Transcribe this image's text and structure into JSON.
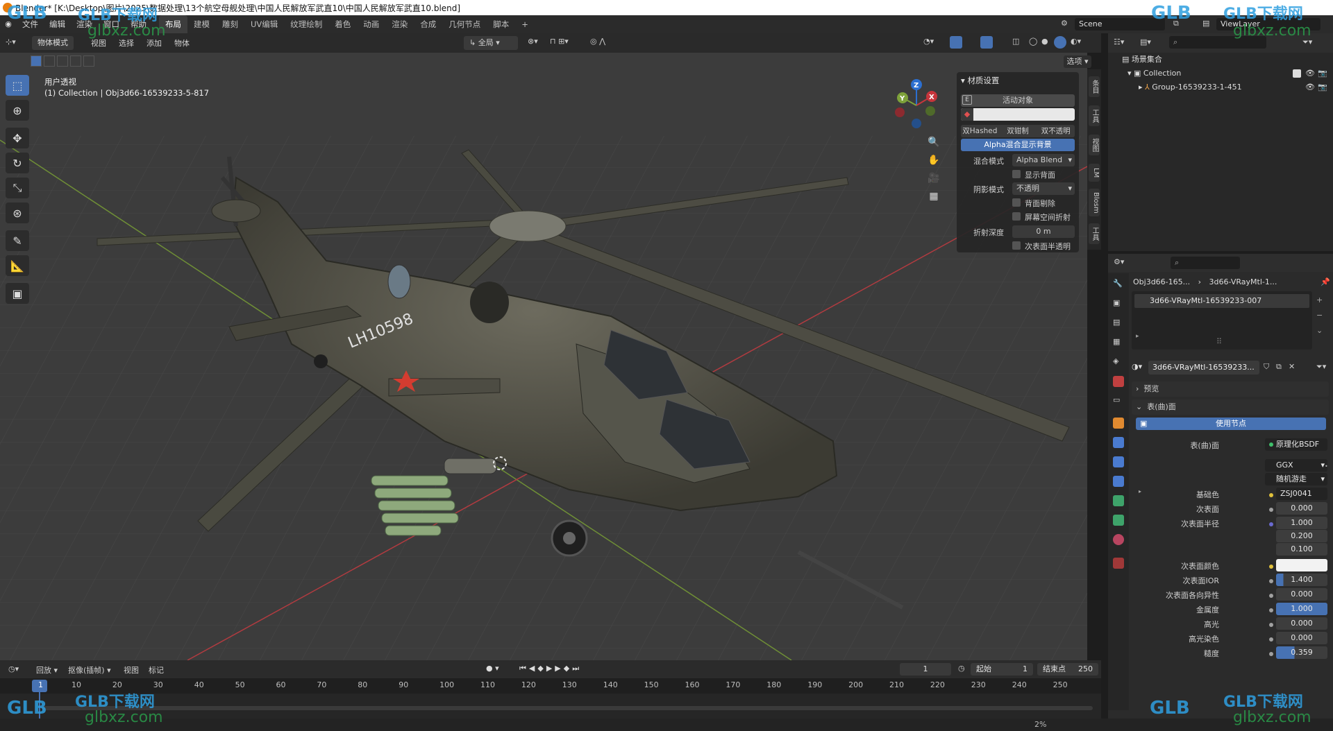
{
  "window": {
    "title": "Blender* [K:\\Desktop\\图片\\2025\\数据处理\\13个航空母舰处理\\中国人民解放军武直10\\中国人民解放军武直10.blend]"
  },
  "topbar": {
    "menus": [
      "文件",
      "编辑",
      "渲染",
      "窗口",
      "帮助"
    ],
    "workspaces": [
      "布局",
      "建模",
      "雕刻",
      "UV编辑",
      "纹理绘制",
      "着色",
      "动画",
      "渲染",
      "合成",
      "几何节点",
      "脚本"
    ],
    "active_workspace": "布局",
    "add_tab": "+",
    "scene": "Scene",
    "view_layer": "ViewLayer"
  },
  "viewport_header": {
    "mode": "物体模式",
    "menus": [
      "视图",
      "选择",
      "添加",
      "物体"
    ],
    "transform_orientation": "全局",
    "options": "选项"
  },
  "viewport": {
    "view_name": "用户透视",
    "collection_info": "(1) Collection | Obj3d66-16539233-5-817",
    "gizmo": {
      "x": "X",
      "y": "Y",
      "z": "Z"
    },
    "helicopter_marking": "LH10598"
  },
  "material_panel": {
    "title": "材质设置",
    "e_label": "E",
    "active_object": "活动对象",
    "blend_buttons": [
      "双Hashed",
      "双钳制",
      "双不透明"
    ],
    "alpha_button": "Alpha混合显示背景",
    "blend_mode_label": "混合模式",
    "blend_mode_value": "Alpha Blend",
    "show_backface": "显示背面",
    "shadow_mode_label": "阴影模式",
    "shadow_mode_value": "不透明",
    "backface_culling": "背面剔除",
    "screen_space_refraction": "屏幕空间折射",
    "refraction_depth_label": "折射深度",
    "refraction_depth_value": "0 m",
    "subsurface_translucency": "次表面半透明"
  },
  "side_tabs": [
    "条目",
    "工具",
    "视图",
    "LM",
    "Blosm",
    "工具"
  ],
  "outliner": {
    "root": "场景集合",
    "collection": "Collection",
    "group": "Group-16539233-1-451"
  },
  "properties": {
    "breadcrumb_object": "Obj3d66-165...",
    "breadcrumb_material": "3d66-VRayMtl-1...",
    "slot_name": "3d66-VRayMtl-16539233-007",
    "material_name": "3d66-VRayMtl-16539233...",
    "preview_label": "预览",
    "surface_section": "表(曲)面",
    "use_nodes": "使用节点",
    "surface_label": "表(曲)面",
    "surface_value": "原理化BSDF",
    "distribution": "GGX",
    "subsurface_method": "随机游走",
    "rows": [
      {
        "label": "基础色",
        "value": "ZSJ0041"
      },
      {
        "label": "次表面",
        "value": "0.000"
      },
      {
        "label": "次表面半径",
        "value": "1.000"
      },
      {
        "label": "",
        "value": "0.200"
      },
      {
        "label": "",
        "value": "0.100"
      },
      {
        "label": "次表面颜色",
        "value": ""
      },
      {
        "label": "次表面IOR",
        "value": "1.400"
      },
      {
        "label": "次表面各向异性",
        "value": "0.000"
      },
      {
        "label": "金属度",
        "value": "1.000"
      },
      {
        "label": "高光",
        "value": "0.000"
      },
      {
        "label": "高光染色",
        "value": "0.000"
      },
      {
        "label": "糙度",
        "value": "0.359"
      }
    ]
  },
  "timeline": {
    "menus": [
      "回放",
      "抠像(插帧)",
      "视图",
      "标记"
    ],
    "current_frame": "1",
    "start_label": "起始",
    "start_value": "1",
    "end_label": "结束点",
    "end_value": "250",
    "ticks": [
      "1",
      "10",
      "20",
      "30",
      "40",
      "50",
      "60",
      "70",
      "80",
      "90",
      "100",
      "110",
      "120",
      "130",
      "140",
      "150",
      "160",
      "170",
      "180",
      "190",
      "200",
      "210",
      "220",
      "230",
      "240",
      "250"
    ]
  },
  "watermark": {
    "brand": "GLB下载网",
    "url": "glbxz.com",
    "logo": "GLB"
  },
  "statusbar": {
    "right": "2%"
  },
  "colors": {
    "accent": "#4772b3",
    "x_axis": "#c7353c",
    "y_axis": "#7ea23a",
    "z_axis": "#2c6fd0",
    "base_color_dot": "#e0c03b"
  }
}
